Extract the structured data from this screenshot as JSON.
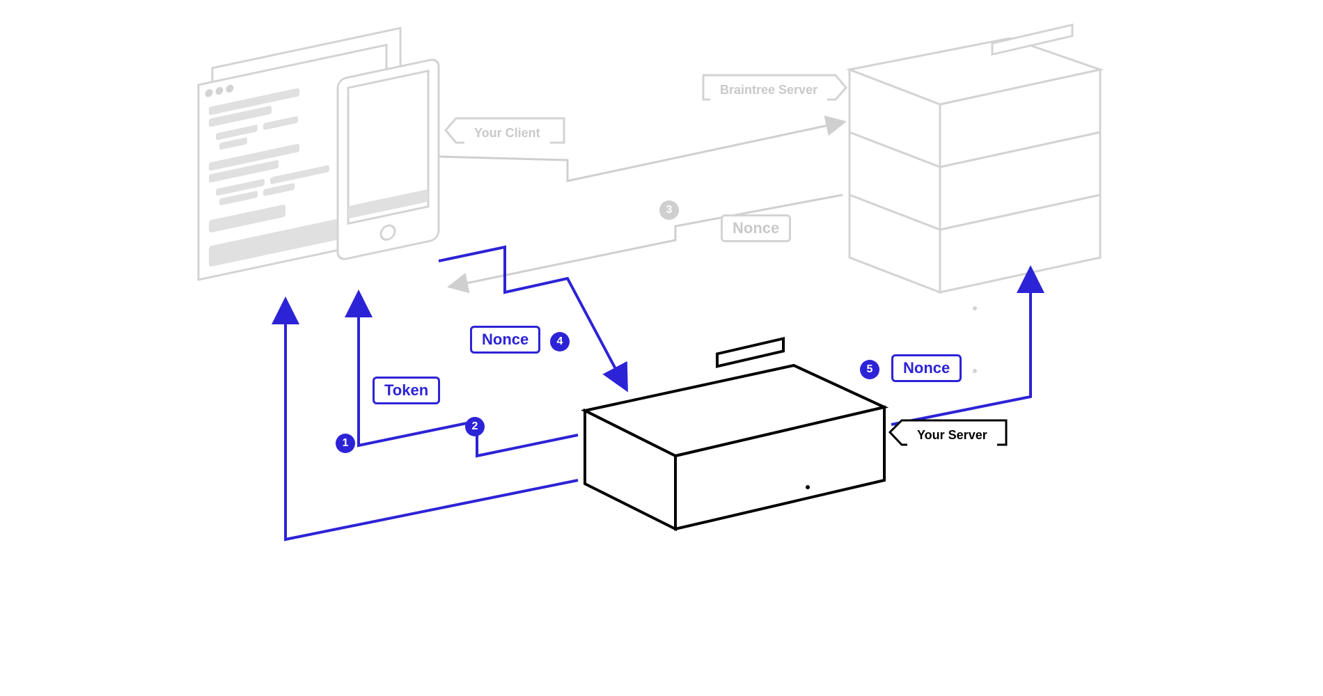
{
  "labels": {
    "your_client": "Your Client",
    "braintree_server": "Braintree Server",
    "nonce_top": "Nonce",
    "nonce_mid": "Nonce",
    "nonce_right": "Nonce",
    "token": "Token",
    "your_server": "Your Server"
  },
  "steps": {
    "s1": "1",
    "s2": "2",
    "s3": "3",
    "s4": "4",
    "s5": "5"
  },
  "colors": {
    "blue": "#2d23d6",
    "faded": "#d3d3d3",
    "black": "#000000"
  }
}
